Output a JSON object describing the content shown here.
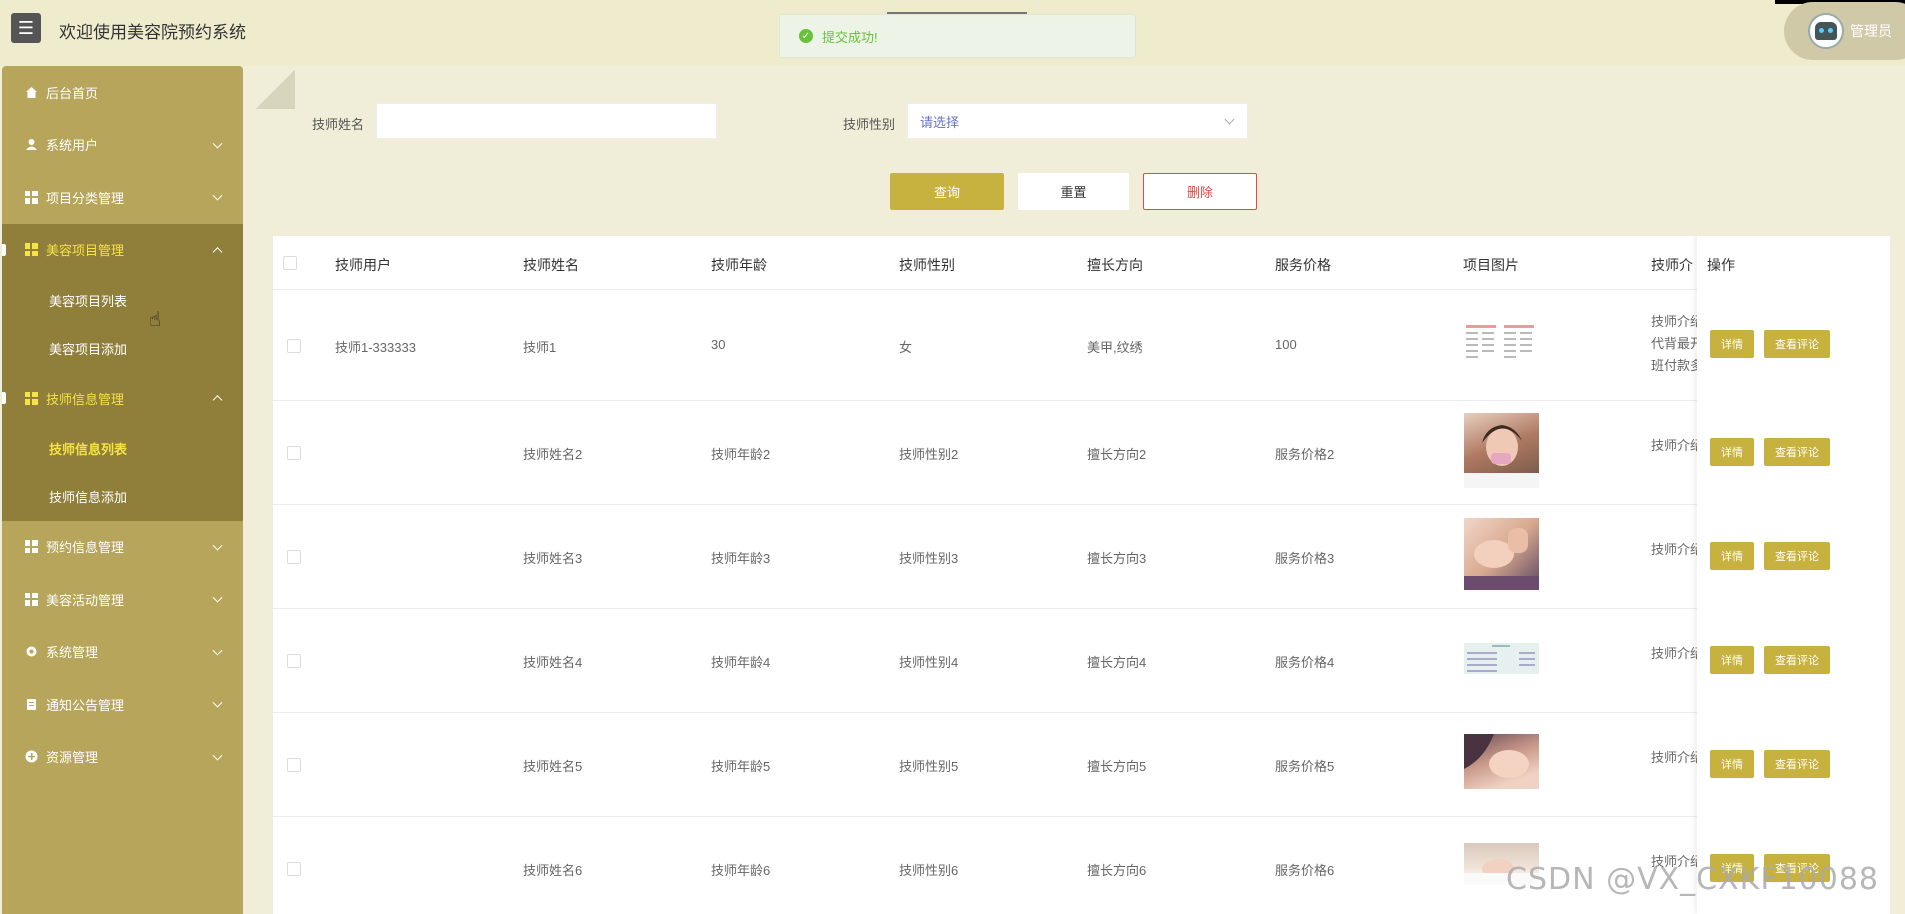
{
  "header": {
    "title": "欢迎使用美容院预约系统",
    "user": "管理员",
    "toast": "提交成功!"
  },
  "sidebar": {
    "items": [
      {
        "label": "后台首页"
      },
      {
        "label": "系统用户"
      },
      {
        "label": "项目分类管理"
      },
      {
        "label": "美容项目管理",
        "children": [
          "美容项目列表",
          "美容项目添加"
        ]
      },
      {
        "label": "技师信息管理",
        "children": [
          "技师信息列表",
          "技师信息添加"
        ]
      },
      {
        "label": "预约信息管理"
      },
      {
        "label": "美容活动管理"
      },
      {
        "label": "系统管理"
      },
      {
        "label": "通知公告管理"
      },
      {
        "label": "资源管理"
      }
    ]
  },
  "search": {
    "name_label": "技师姓名",
    "name_value": "",
    "gender_label": "技师性别",
    "gender_placeholder": "请选择",
    "query": "查询",
    "reset": "重置",
    "delete": "删除"
  },
  "table": {
    "columns": [
      "技师用户",
      "技师姓名",
      "技师年龄",
      "技师性别",
      "擅长方向",
      "服务价格",
      "项目图片",
      "技师介",
      "操作"
    ],
    "rows": [
      {
        "user": "技师1-333333",
        "name": "技师1",
        "age": "30",
        "gender": "女",
        "skill": "美甲,纹绣",
        "price": "100",
        "intro": [
          "技师介绍",
          "代背最开",
          "班付款多"
        ]
      },
      {
        "user": "",
        "name": "技师姓名2",
        "age": "技师年龄2",
        "gender": "技师性别2",
        "skill": "擅长方向2",
        "price": "服务价格2",
        "intro": [
          "技师介绍"
        ]
      },
      {
        "user": "",
        "name": "技师姓名3",
        "age": "技师年龄3",
        "gender": "技师性别3",
        "skill": "擅长方向3",
        "price": "服务价格3",
        "intro": [
          "技师介绍"
        ]
      },
      {
        "user": "",
        "name": "技师姓名4",
        "age": "技师年龄4",
        "gender": "技师性别4",
        "skill": "擅长方向4",
        "price": "服务价格4",
        "intro": [
          "技师介绍"
        ]
      },
      {
        "user": "",
        "name": "技师姓名5",
        "age": "技师年龄5",
        "gender": "技师性别5",
        "skill": "擅长方向5",
        "price": "服务价格5",
        "intro": [
          "技师介绍"
        ]
      },
      {
        "user": "",
        "name": "技师姓名6",
        "age": "技师年龄6",
        "gender": "技师性别6",
        "skill": "擅长方向6",
        "price": "服务价格6",
        "intro": [
          "技师介绍"
        ]
      }
    ],
    "detail_label": "详情",
    "review_label": "查看评论"
  },
  "watermark": "CSDN @VX_CXKF10088",
  "colors": {
    "accent": "#c7b13f",
    "sidebar": "#b6a55a",
    "sidebar_active": "#8f7f3a",
    "highlight": "#f7e247",
    "danger": "#e44444"
  }
}
